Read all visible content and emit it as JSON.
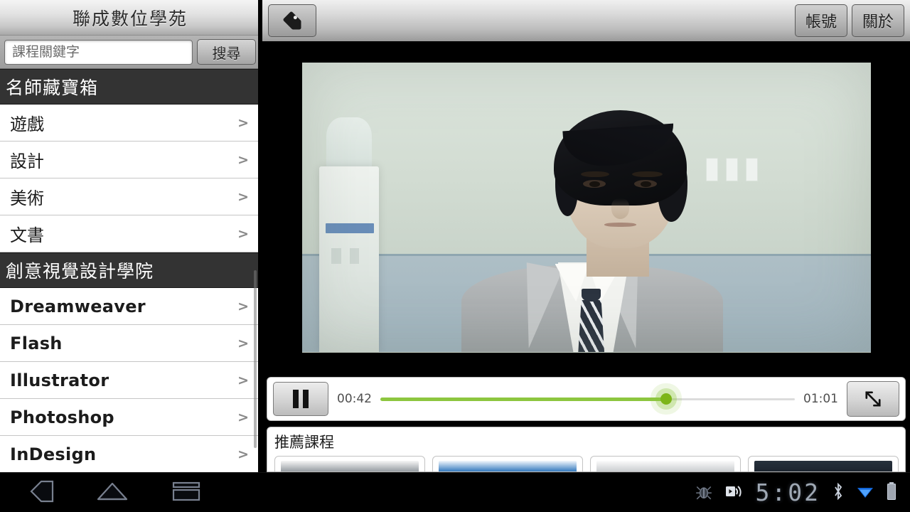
{
  "sidebar": {
    "title": "聯成數位學苑",
    "search": {
      "placeholder": "課程關鍵字",
      "value": "",
      "button_label": "搜尋"
    },
    "sections": [
      {
        "header": "名師藏寶箱",
        "items": [
          {
            "label": "遊戲",
            "chevron": ">"
          },
          {
            "label": "設計",
            "chevron": ">"
          },
          {
            "label": "美術",
            "chevron": ">"
          },
          {
            "label": "文書",
            "chevron": ">"
          }
        ]
      },
      {
        "header": "創意視覺設計學院",
        "items": [
          {
            "label": "Dreamweaver",
            "chevron": ">"
          },
          {
            "label": "Flash",
            "chevron": ">"
          },
          {
            "label": "Illustrator",
            "chevron": ">"
          },
          {
            "label": "Photoshop",
            "chevron": ">"
          },
          {
            "label": "InDesign",
            "chevron": ">"
          }
        ]
      }
    ]
  },
  "topbar": {
    "tag_icon": "tag-icon",
    "account_label": "帳號",
    "about_label": "關於"
  },
  "player": {
    "state": "playing",
    "pause_icon": "pause-icon",
    "current_time": "00:42",
    "total_time": "01:01",
    "progress_percent": 69,
    "fullscreen_icon": "fullscreen-icon",
    "accent_color": "#8dc63f"
  },
  "recommended": {
    "title": "推薦課程",
    "cards": [
      {
        "thumb_color": "#9aa0a6"
      },
      {
        "thumb_color": "#3d7fc1"
      },
      {
        "thumb_color": "#c8cbce"
      },
      {
        "thumb_color": "#27313c"
      }
    ]
  },
  "system_bar": {
    "nav": [
      {
        "name": "back-icon"
      },
      {
        "name": "home-icon"
      },
      {
        "name": "recent-apps-icon"
      }
    ],
    "clock": "5:02",
    "status_icons": [
      {
        "name": "usb-debug-icon"
      },
      {
        "name": "screen-cast-icon"
      },
      {
        "name": "bluetooth-icon"
      },
      {
        "name": "wifi-icon"
      },
      {
        "name": "battery-icon"
      }
    ]
  }
}
